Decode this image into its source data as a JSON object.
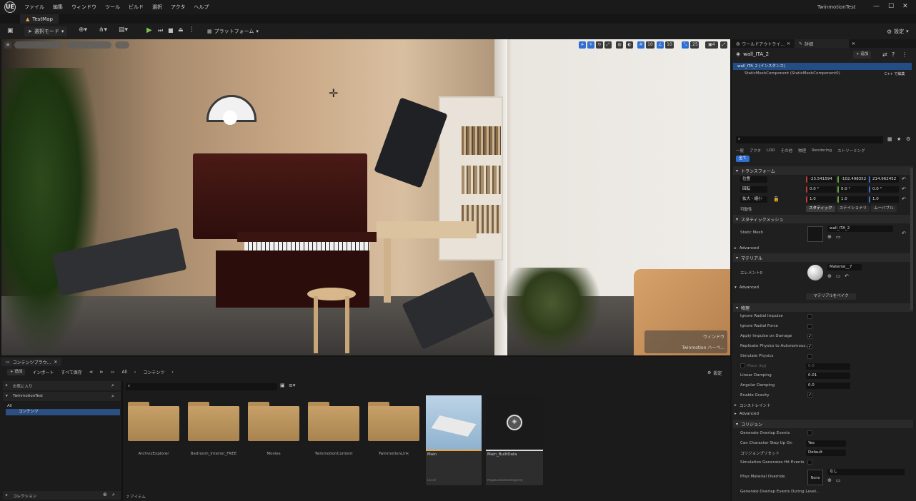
{
  "app": {
    "logo": "UE",
    "window_title": "TwinmotionTest",
    "level_tab": "TestMap"
  },
  "menu": [
    "ファイル",
    "編集",
    "ウィンドウ",
    "ツール",
    "ビルド",
    "選択",
    "アクタ",
    "ヘルプ"
  ],
  "window_controls": [
    "—",
    "☐",
    "✕"
  ],
  "toolbar": {
    "select_mode": "選択モード",
    "platform": "プラットフォーム",
    "settings": "設定"
  },
  "right_panel": {
    "tabs": [
      "ワールドアウトライ...",
      "詳細"
    ],
    "actor_name": "wall_ITA_2",
    "add_label": "+ 追加",
    "hierarchy": [
      "wall_ITA_2 (インスタンス)",
      "StaticMeshComponent (StaticMeshComponent0)"
    ],
    "edit_label": "C++ で編集",
    "filter_tabs": [
      "一般",
      "アクタ",
      "LOD",
      "その他",
      "物理",
      "Rendering",
      "ストリーミング"
    ],
    "all_label": "全て",
    "sections": {
      "transform": "トランスフォーム",
      "static_mesh": "スタティックメッシュ",
      "advanced": "Advanced",
      "materials": "マテリアル",
      "physics": "物理",
      "constraints": "コンストレイント",
      "collision": "コリジョン"
    },
    "transform": {
      "location_label": "位置",
      "rotation_label": "回転",
      "scale_label": "拡大・縮小",
      "mobility_label": "可動性",
      "location": [
        "-23.541594",
        "-102.498352",
        "214.962452"
      ],
      "rotation": [
        "0.0 °",
        "0.0 °",
        "0.0 °"
      ],
      "scale": [
        "1.0",
        "1.0",
        "1.0"
      ],
      "mobility_options": [
        "スタティック",
        "ステイショナリ",
        "ムーバブル"
      ]
    },
    "static_mesh": {
      "label": "Static Mesh",
      "value": "wall_ITA_2"
    },
    "materials": {
      "label": "エレメント0",
      "value": "Material__7"
    },
    "bake_button": "マテリアルをベイク",
    "physics_rows": [
      {
        "label": "Ignore Radial Impulse",
        "checked": false
      },
      {
        "label": "Ignore Radial Force",
        "checked": false
      },
      {
        "label": "Apply Impulse on Damage",
        "checked": true
      },
      {
        "label": "Replicate Physics to Autonomous...",
        "checked": true
      },
      {
        "label": "Simulate Physics",
        "checked": false
      },
      {
        "label": "Mass (kg)",
        "checked": false
      }
    ],
    "mass_value": "0.0",
    "linear_damping": {
      "label": "Linear Damping",
      "value": "0.01"
    },
    "angular_damping": {
      "label": "Angular Damping",
      "value": "0.0"
    },
    "enable_gravity": "Enable Gravity",
    "collision_rows": {
      "overlap": "Generate Overlap Events",
      "step_up": "Can Character Step Up On",
      "step_up_value": "Yes",
      "preset": "コリジョンプリセット",
      "preset_value": "Default",
      "simple_complex": "Simulation Generates Hit Events",
      "phys_override": "Phys Material Override",
      "phys_value": "なし",
      "phys_none": "None",
      "generate_events": "Generate Overlap Events During Level..."
    }
  },
  "content_browser": {
    "tab": "コンテンツブラウ...",
    "add": "+ 追加",
    "import": "インポート",
    "save_all": "すべて保存",
    "path": [
      "All",
      "コンテンツ"
    ],
    "settings": "設定",
    "favorites": "お気に入り",
    "project": "TwinmotionTest",
    "tree": [
      "All",
      "コンテンツ"
    ],
    "collections": "コレクション",
    "item_count": "7 アイテム",
    "items": [
      {
        "name": "ArchvizExplorer",
        "type": "folder"
      },
      {
        "name": "Bedroom_Interior_FREE",
        "type": "folder"
      },
      {
        "name": "Movies",
        "type": "folder"
      },
      {
        "name": "TwinmotionContent",
        "type": "folder"
      },
      {
        "name": "TwinmotionLink",
        "type": "folder"
      },
      {
        "name": "Main",
        "type": "level",
        "subtitle": "Level"
      },
      {
        "name": "Main_BuiltData",
        "type": "data",
        "subtitle": "MapBuildDataRegistry"
      }
    ]
  },
  "viewport": {
    "overlay_label": "ウィンドウ",
    "overlay_sub": "Twinmotion ハーベ..."
  },
  "colors": {
    "accent": "#2f6fd1",
    "folder": "#c6a067",
    "panel": "#1f1f1f"
  }
}
